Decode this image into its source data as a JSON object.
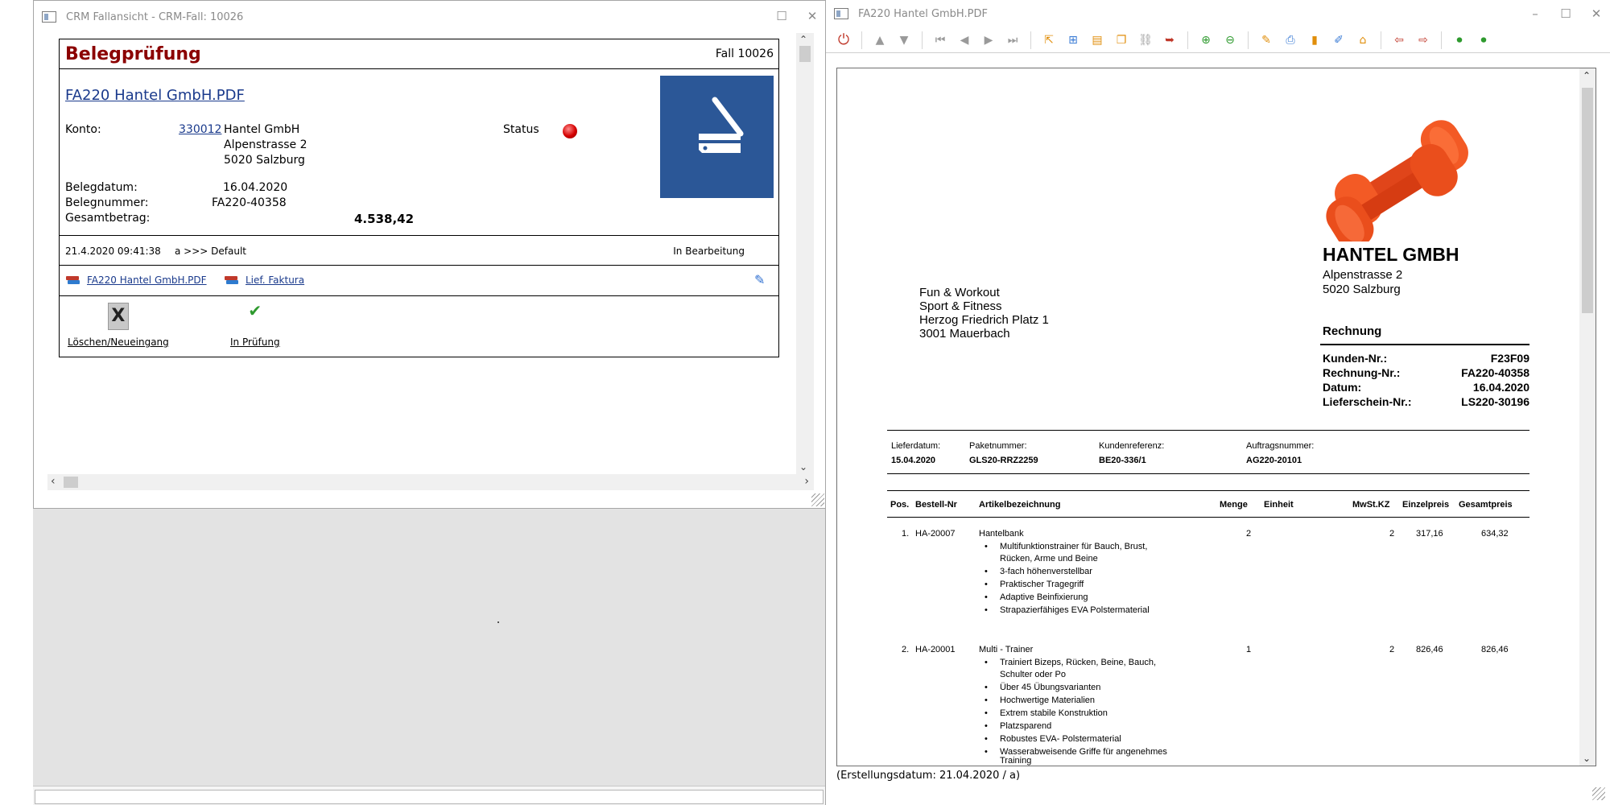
{
  "crm_window": {
    "title": "CRM Fallansicht - CRM-Fall: 10026",
    "case": {
      "title": "Belegprüfung",
      "case_number": "Fall 10026",
      "document_link": "FA220 Hantel GmbH.PDF",
      "konto_label": "Konto:",
      "konto_number": "330012",
      "address": [
        "Hantel GmbH",
        "Alpenstrasse 2",
        "5020 Salzburg"
      ],
      "status_label": "Status",
      "status_color": "#d40000",
      "belegdatum_label": "Belegdatum:",
      "belegdatum_value": "16.04.2020",
      "belegnummer_label": "Belegnummer:",
      "belegnummer_value": "FA220-40358",
      "gesamtbetrag_label": "Gesamtbetrag:",
      "gesamtbetrag_value": "4.538,42",
      "tile_color": "#2b5797"
    },
    "event": {
      "timestamp": "21.4.2020 09:41:38",
      "text": "a >>> Default",
      "state": "In Bearbeitung"
    },
    "attachments": [
      {
        "label": "FA220 Hantel GmbH.PDF",
        "icon": "books-icon"
      },
      {
        "label": "Lief. Faktura",
        "icon": "books-icon"
      }
    ],
    "actions": {
      "delete_label": "Löschen/Neueingang",
      "delete_glyph": "X",
      "review_label": "In Prüfung",
      "review_glyph": "✔"
    }
  },
  "pdf_window": {
    "title": "FA220 Hantel GmbH.PDF",
    "footer": "(Erstellungsdatum: 21.04.2020 / a)",
    "invoice": {
      "company_name": "HANTEL GMBH",
      "company_street": "Alpenstrasse 2",
      "company_city": "5020 Salzburg",
      "recipient": [
        "Fun & Workout",
        "Sport & Fitness",
        "Herzog Friedrich Platz 1",
        "3001 Mauerbach"
      ],
      "doc_title": "Rechnung",
      "meta": [
        {
          "label": "Kunden-Nr.:",
          "value": "F23F09"
        },
        {
          "label": "Rechnung-Nr.:",
          "value": "FA220-40358"
        },
        {
          "label": "Datum:",
          "value": "16.04.2020"
        },
        {
          "label": "Lieferschein-Nr.:",
          "value": "LS220-30196"
        }
      ],
      "shipping": [
        {
          "label": "Lieferdatum:",
          "value": "15.04.2020"
        },
        {
          "label": "Paketnummer:",
          "value": "GLS20-RRZ2259"
        },
        {
          "label": "Kundenreferenz:",
          "value": "BE20-336/1"
        },
        {
          "label": "Auftragsnummer:",
          "value": "AG220-20101"
        }
      ],
      "columns": [
        "Pos.",
        "Bestell-Nr",
        "Artikelbezeichnung",
        "Menge",
        "Einheit",
        "MwSt.KZ",
        "Einzelpreis",
        "Gesamtpreis"
      ],
      "items": [
        {
          "pos": "1.",
          "order_no": "HA-20007",
          "name": "Hantelbank",
          "qty": "2",
          "vat": "2",
          "unit_price": "317,16",
          "total": "634,32",
          "features": [
            "Multifunktionstrainer für Bauch, Brust,",
            "Rücken, Arme und Beine",
            "3-fach höhenverstellbar",
            "Praktischer Tragegriff",
            "Adaptive Beinfixierung",
            "Strapazierfähiges EVA Polstermaterial"
          ]
        },
        {
          "pos": "2.",
          "order_no": "HA-20001",
          "name": "Multi - Trainer",
          "qty": "1",
          "vat": "2",
          "unit_price": "826,46",
          "total": "826,46",
          "features": [
            "Trainiert Bizeps, Rücken, Beine, Bauch,",
            "Schulter oder Po",
            "Über 45 Übungsvarianten",
            "Hochwertige Materialien",
            "Extrem stabile Konstruktion",
            "Platzsparend",
            "Robustes EVA- Polstermaterial",
            "Wasserabweisende Griffe für angenehmes",
            "Training"
          ]
        }
      ]
    }
  }
}
